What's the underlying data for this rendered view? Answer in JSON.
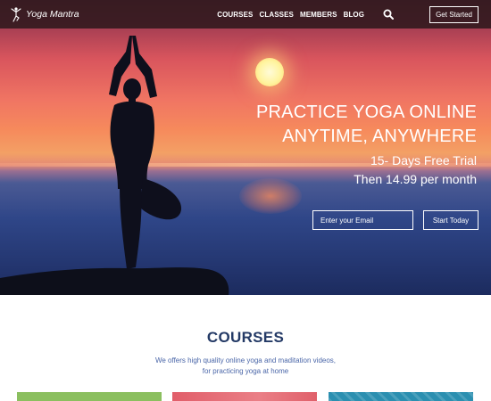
{
  "brand": {
    "name": "Yoga Mantra",
    "logo_icon": "yoga-pose-icon"
  },
  "nav": {
    "links": [
      "COURSES",
      "CLASSES",
      "MEMBERS",
      "BLOG"
    ],
    "search_icon": "search-icon",
    "cta_label": "Get Started"
  },
  "hero": {
    "title_line1": "PRACTICE YOGA ONLINE",
    "title_line2": "ANYTIME, ANYWHERE",
    "trial_line": "15- Days Free Trial",
    "price_line": "Then 14.99 per month",
    "email_placeholder": "Enter your Email",
    "submit_label": "Start Today"
  },
  "courses": {
    "title": "COURSES",
    "desc_line1": "We offers high quality online yoga and maditation videos,",
    "desc_line2": "for practicing yoga at home"
  },
  "colors": {
    "navbar_bg": "#341a20",
    "section_title": "#243a66",
    "section_text": "#4a66a8",
    "card_green": "#8bbf5f",
    "card_red": "#e15e6a",
    "card_teal": "#2b8fb0"
  }
}
